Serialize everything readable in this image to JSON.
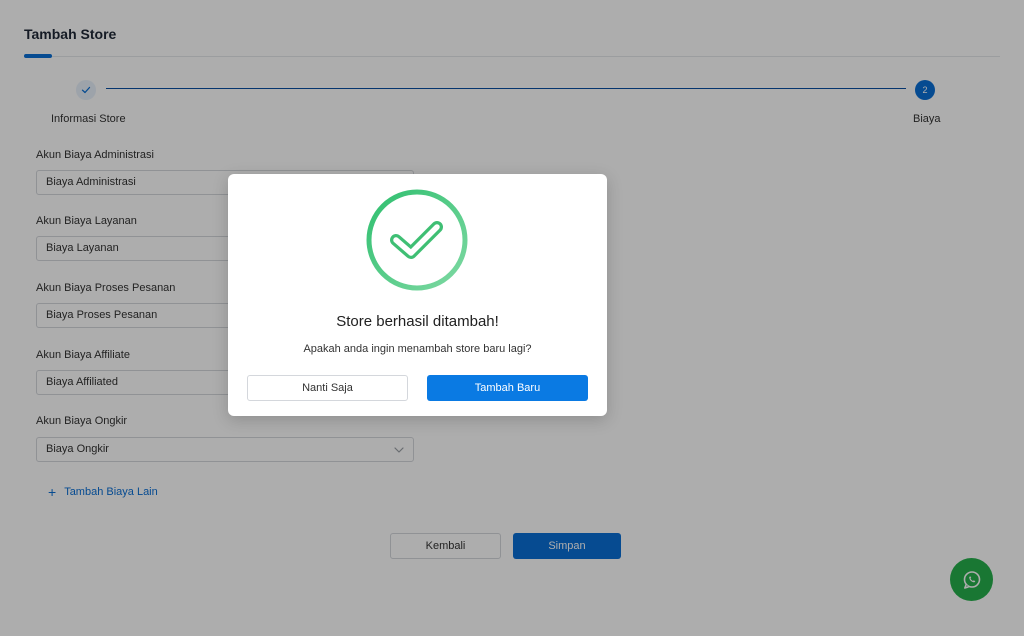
{
  "page": {
    "title": "Tambah Store"
  },
  "stepper": {
    "steps": [
      {
        "label": "Informasi Store",
        "status": "completed",
        "indicator": "check-icon"
      },
      {
        "label": "Biaya",
        "status": "active",
        "number": "2"
      }
    ]
  },
  "form": {
    "fields": [
      {
        "label": "Akun Biaya Administrasi",
        "value": "Biaya Administrasi"
      },
      {
        "label": "Akun Biaya Layanan",
        "value": "Biaya Layanan"
      },
      {
        "label": "Akun Biaya Proses Pesanan",
        "value": "Biaya Proses Pesanan"
      },
      {
        "label": "Akun Biaya Affiliate",
        "value": "Biaya Affiliated"
      },
      {
        "label": "Akun Biaya Ongkir",
        "value": "Biaya Ongkir"
      }
    ],
    "add_link_label": "Tambah Biaya Lain"
  },
  "footer": {
    "back_label": "Kembali",
    "save_label": "Simpan"
  },
  "modal": {
    "title": "Store berhasil ditambah!",
    "message": "Apakah anda ingin menambah store baru lagi?",
    "later_label": "Nanti Saja",
    "new_label": "Tambah Baru",
    "icon": "success-check-icon"
  },
  "colors": {
    "primary": "#0a6fd6",
    "success": "#3fbf74",
    "whatsapp": "#25b04c"
  }
}
